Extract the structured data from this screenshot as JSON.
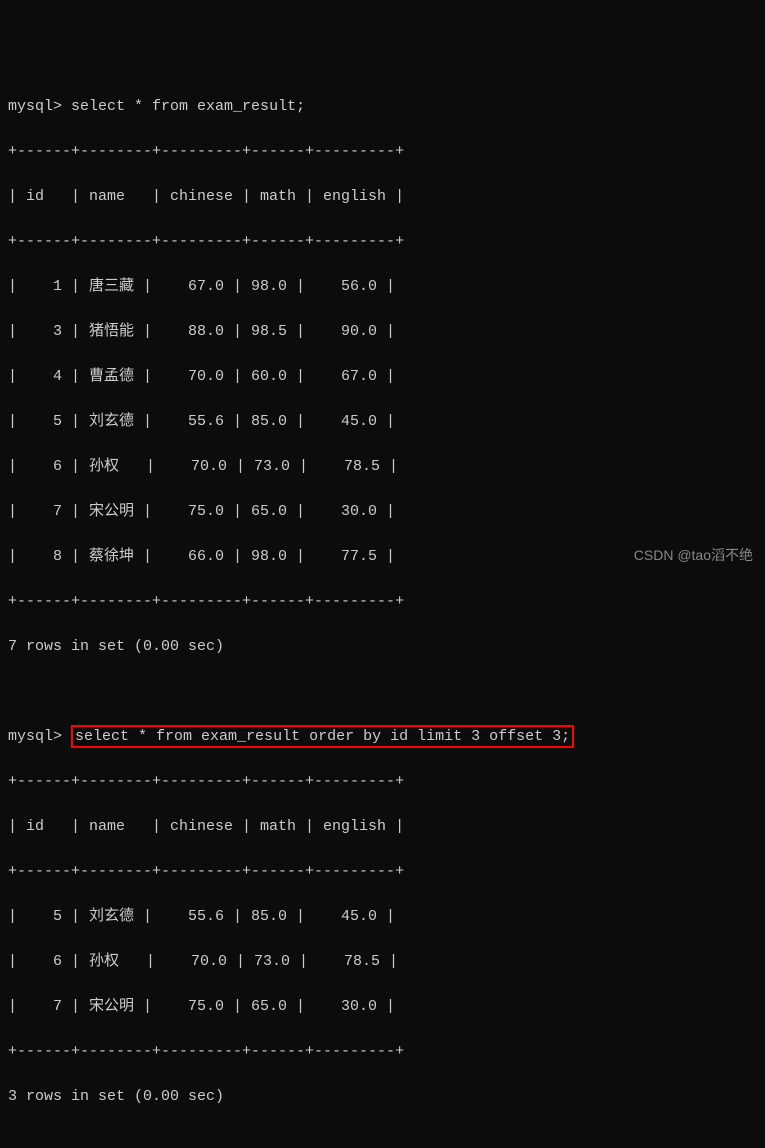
{
  "query1": {
    "prompt": "mysql>",
    "sql": "select * from exam_result;",
    "border": "+------+--------+---------+------+---------+",
    "header": "| id   | name   | chinese | math | english |",
    "rows": [
      "|    1 | 唐三藏 |    67.0 | 98.0 |    56.0 |",
      "|    3 | 猪悟能 |    88.0 | 98.5 |    90.0 |",
      "|    4 | 曹孟德 |    70.0 | 60.0 |    67.0 |",
      "|    5 | 刘玄德 |    55.6 | 85.0 |    45.0 |",
      "|    6 | 孙权   |    70.0 | 73.0 |    78.5 |",
      "|    7 | 宋公明 |    75.0 | 65.0 |    30.0 |",
      "|    8 | 蔡徐坤 |    66.0 | 98.0 |    77.5 |"
    ],
    "summary": "7 rows in set (0.00 sec)"
  },
  "query2": {
    "prompt": "mysql>",
    "sql": "select * from exam_result order by id limit 3 offset 3;",
    "border": "+------+--------+---------+------+---------+",
    "header": "| id   | name   | chinese | math | english |",
    "rows": [
      "|    5 | 刘玄德 |    55.6 | 85.0 |    45.0 |",
      "|    6 | 孙权   |    70.0 | 73.0 |    78.5 |",
      "|    7 | 宋公明 |    75.0 | 65.0 |    30.0 |"
    ],
    "summary": "3 rows in set (0.00 sec)"
  },
  "chart_data": {
    "type": "table",
    "tables": [
      {
        "columns": [
          "id",
          "name",
          "chinese",
          "math",
          "english"
        ],
        "data": [
          {
            "id": 1,
            "name": "唐三藏",
            "chinese": 67.0,
            "math": 98.0,
            "english": 56.0
          },
          {
            "id": 3,
            "name": "猪悟能",
            "chinese": 88.0,
            "math": 98.5,
            "english": 90.0
          },
          {
            "id": 4,
            "name": "曹孟德",
            "chinese": 70.0,
            "math": 60.0,
            "english": 67.0
          },
          {
            "id": 5,
            "name": "刘玄德",
            "chinese": 55.6,
            "math": 85.0,
            "english": 45.0
          },
          {
            "id": 6,
            "name": "孙权",
            "chinese": 70.0,
            "math": 73.0,
            "english": 78.5
          },
          {
            "id": 7,
            "name": "宋公明",
            "chinese": 75.0,
            "math": 65.0,
            "english": 30.0
          },
          {
            "id": 8,
            "name": "蔡徐坤",
            "chinese": 66.0,
            "math": 98.0,
            "english": 77.5
          }
        ]
      },
      {
        "columns": [
          "id",
          "name",
          "chinese",
          "math",
          "english"
        ],
        "data": [
          {
            "id": 5,
            "name": "刘玄德",
            "chinese": 55.6,
            "math": 85.0,
            "english": 45.0
          },
          {
            "id": 6,
            "name": "孙权",
            "chinese": 70.0,
            "math": 73.0,
            "english": 78.5
          },
          {
            "id": 7,
            "name": "宋公明",
            "chinese": 75.0,
            "math": 65.0,
            "english": 30.0
          }
        ]
      }
    ]
  },
  "watermark": "CSDN @tao滔不绝"
}
